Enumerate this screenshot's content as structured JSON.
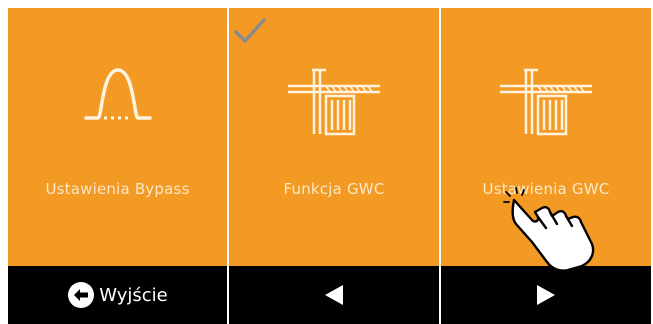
{
  "tiles": [
    {
      "label": "Ustawienia Bypass",
      "icon": "bypass-curve-icon"
    },
    {
      "label": "Funkcja GWC",
      "icon": "gwc-exchanger-icon",
      "checked": true
    },
    {
      "label": "Ustawienia GWC",
      "icon": "gwc-exchanger-icon"
    }
  ],
  "footer": {
    "exit_label": "Wyjście",
    "prev_icon": "arrow-left-icon",
    "next_icon": "arrow-right-icon"
  },
  "colors": {
    "tile": "#f39a24",
    "bar": "#000000",
    "label": "#fde7c6",
    "check": "#8a8a8a"
  }
}
